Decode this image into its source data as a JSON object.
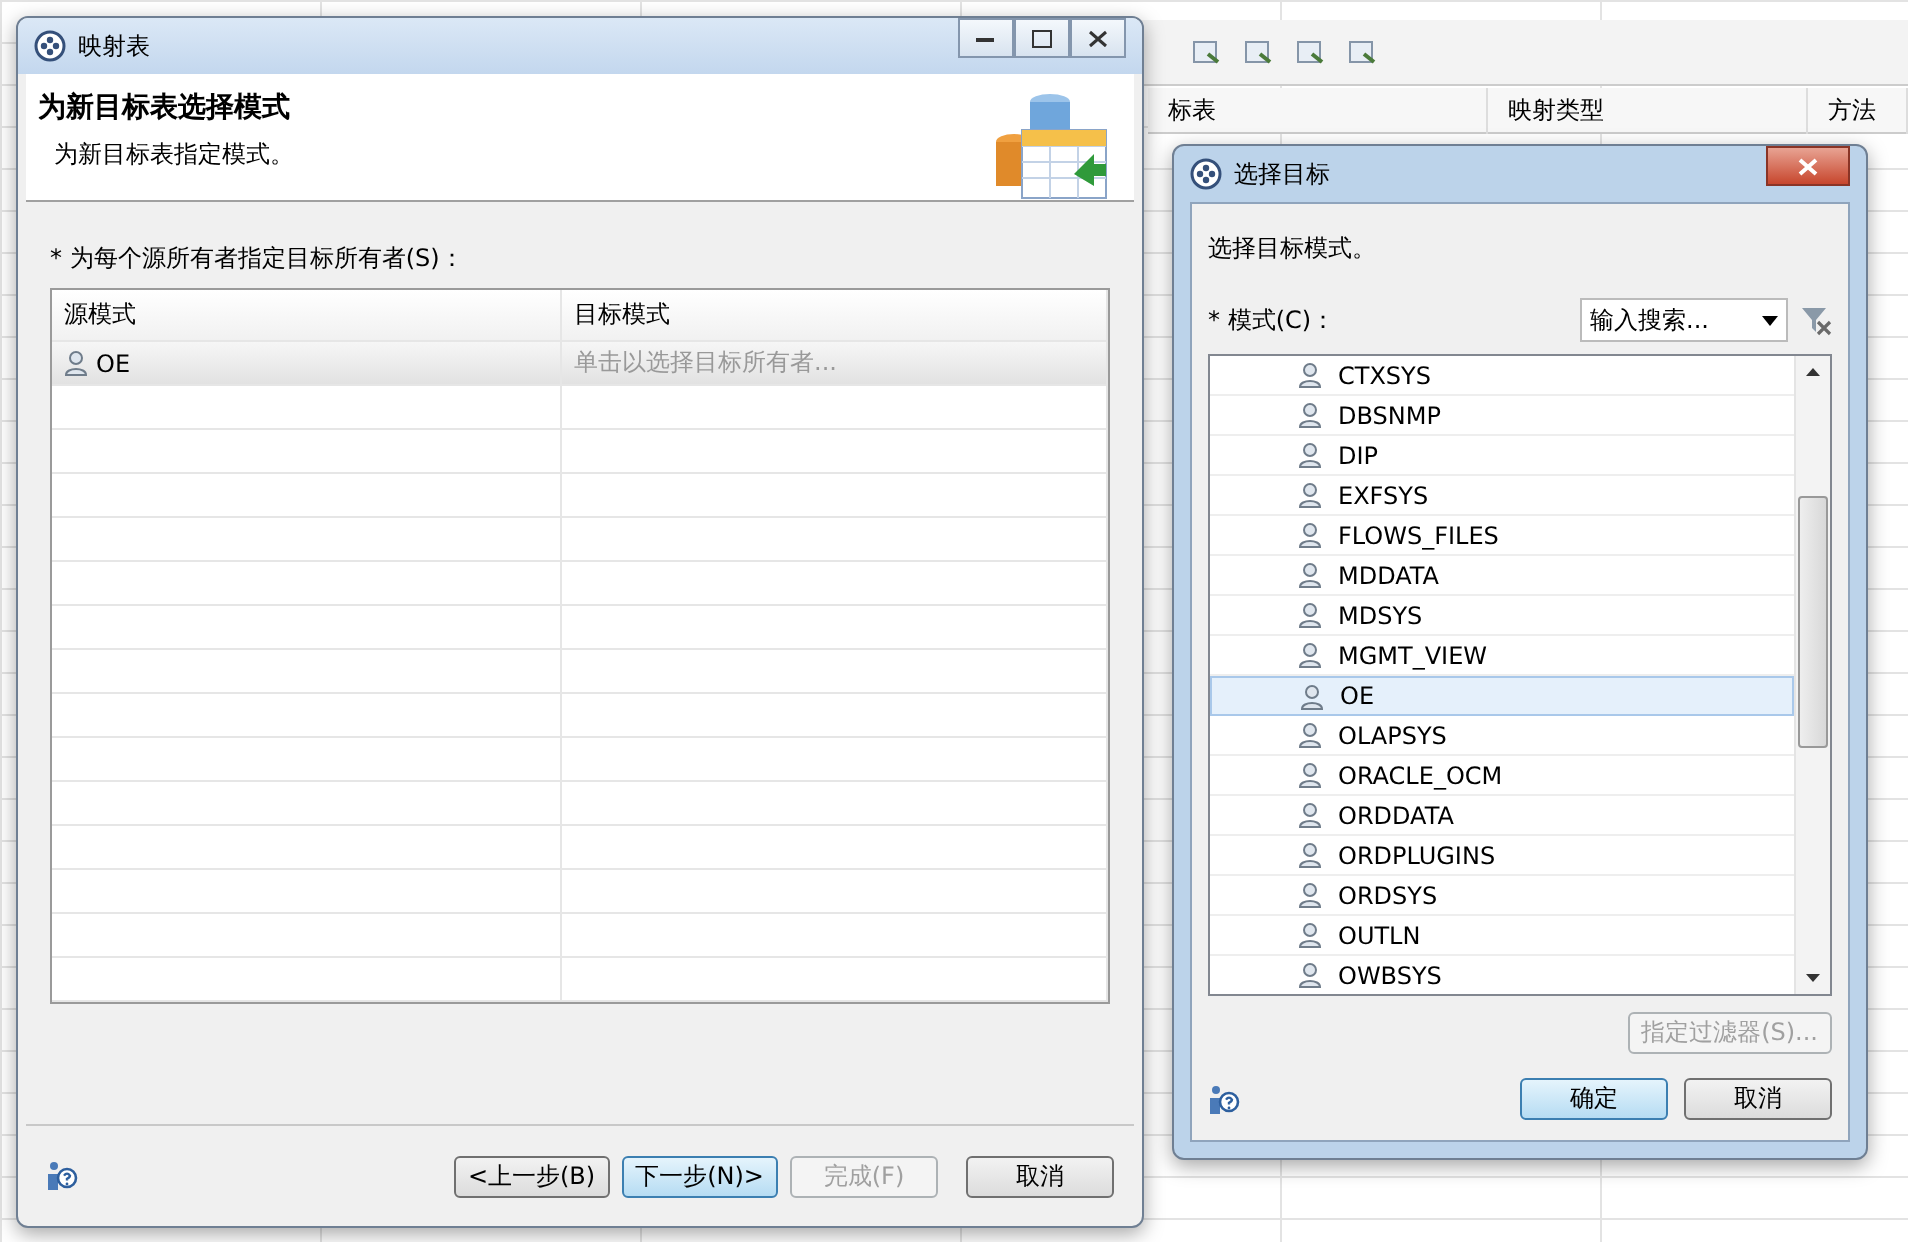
{
  "background": {
    "columns": [
      "标表",
      "映射类型",
      "方法"
    ]
  },
  "wizard": {
    "title": "映射表",
    "banner": {
      "title": "为新目标表选择模式",
      "subtitle": "为新目标表指定模式。"
    },
    "prompt": "* 为每个源所有者指定目标所有者(S)：",
    "table": {
      "columns": [
        "源模式",
        "目标模式"
      ],
      "rows": [
        {
          "source": "OE",
          "target_hint": "单击以选择目标所有者...",
          "selected": true
        }
      ]
    },
    "buttons": [
      {
        "label": "<上一步(B)",
        "default": false,
        "disabled": false
      },
      {
        "label": "下一步(N)>",
        "default": true,
        "disabled": false
      },
      {
        "label": "完成(F)",
        "default": false,
        "disabled": true
      },
      {
        "label": "取消",
        "default": false,
        "disabled": false
      }
    ]
  },
  "dialog": {
    "title": "选择目标",
    "instruction": "选择目标模式。",
    "field_label": "* 模式(C)：",
    "search": {
      "placeholder": "输入搜索..."
    },
    "schemas": [
      {
        "name": "CTXSYS",
        "selected": false
      },
      {
        "name": "DBSNMP",
        "selected": false
      },
      {
        "name": "DIP",
        "selected": false
      },
      {
        "name": "EXFSYS",
        "selected": false
      },
      {
        "name": "FLOWS_FILES",
        "selected": false
      },
      {
        "name": "MDDATA",
        "selected": false
      },
      {
        "name": "MDSYS",
        "selected": false
      },
      {
        "name": "MGMT_VIEW",
        "selected": false
      },
      {
        "name": "OE",
        "selected": true
      },
      {
        "name": "OLAPSYS",
        "selected": false
      },
      {
        "name": "ORACLE_OCM",
        "selected": false
      },
      {
        "name": "ORDDATA",
        "selected": false
      },
      {
        "name": "ORDPLUGINS",
        "selected": false
      },
      {
        "name": "ORDSYS",
        "selected": false
      },
      {
        "name": "OUTLN",
        "selected": false
      },
      {
        "name": "OWBSYS",
        "selected": false
      }
    ],
    "filter_button": {
      "label": "指定过滤器(S)...",
      "disabled": true
    },
    "buttons": [
      {
        "label": "确定",
        "default": true,
        "disabled": false
      },
      {
        "label": "取消",
        "default": false,
        "disabled": false
      }
    ]
  }
}
